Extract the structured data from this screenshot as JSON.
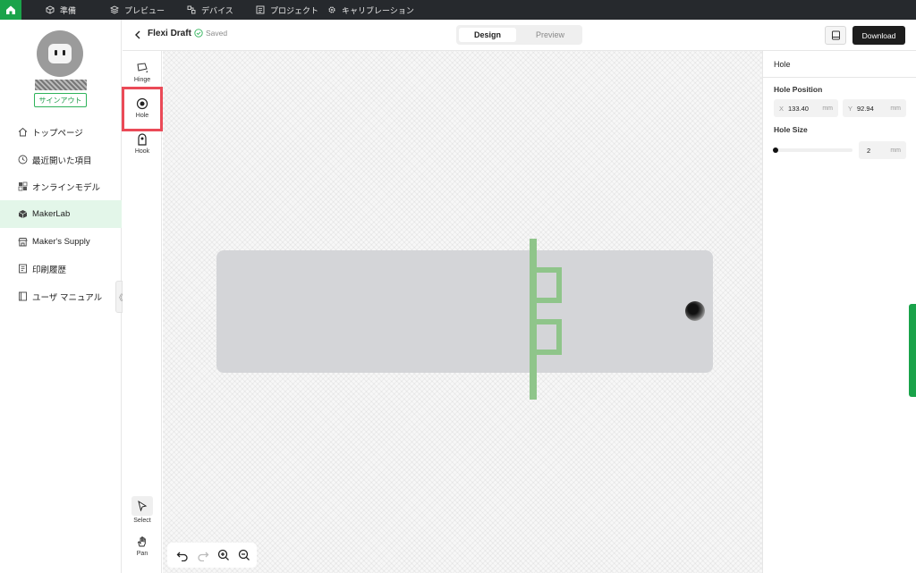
{
  "topnav": {
    "items": [
      {
        "label": "準備",
        "icon": "cube-icon"
      },
      {
        "label": "プレビュー",
        "icon": "layers-icon"
      },
      {
        "label": "デバイス",
        "icon": "devices-icon"
      },
      {
        "label": "プロジェクト",
        "icon": "list-icon"
      },
      {
        "label": "キャリブレーション",
        "icon": "gear-icon"
      }
    ]
  },
  "sidebar": {
    "signout_label": "サインアウト",
    "items": [
      {
        "label": "トップページ",
        "icon": "home-icon"
      },
      {
        "label": "最近開いた項目",
        "icon": "clock-icon"
      },
      {
        "label": "オンラインモデル",
        "icon": "cubes-icon"
      },
      {
        "label": "MakerLab",
        "icon": "lab-cube-icon",
        "active": true
      },
      {
        "label": "Maker's Supply",
        "icon": "store-icon"
      },
      {
        "label": "印刷履歴",
        "icon": "history-icon"
      },
      {
        "label": "ユーザ マニュアル",
        "icon": "book-icon"
      }
    ],
    "collapse_label": "《"
  },
  "editor": {
    "title": "Flexi Draft",
    "status": "Saved",
    "tabs": {
      "design": "Design",
      "preview": "Preview"
    },
    "download_label": "Download"
  },
  "tools": {
    "hinge": "Hinge",
    "hole": "Hole",
    "hook": "Hook",
    "select": "Select",
    "pan": "Pan"
  },
  "properties": {
    "title": "Hole",
    "position_label": "Hole Position",
    "x_axis": "X",
    "x_value": "133.40",
    "y_axis": "Y",
    "y_value": "92.94",
    "unit": "mm",
    "size_label": "Hole Size",
    "size_value": "2"
  },
  "colors": {
    "accent": "#1aa34a",
    "hinge": "#8fc58a",
    "highlight": "#ea4a57",
    "topbar": "#26292d"
  }
}
